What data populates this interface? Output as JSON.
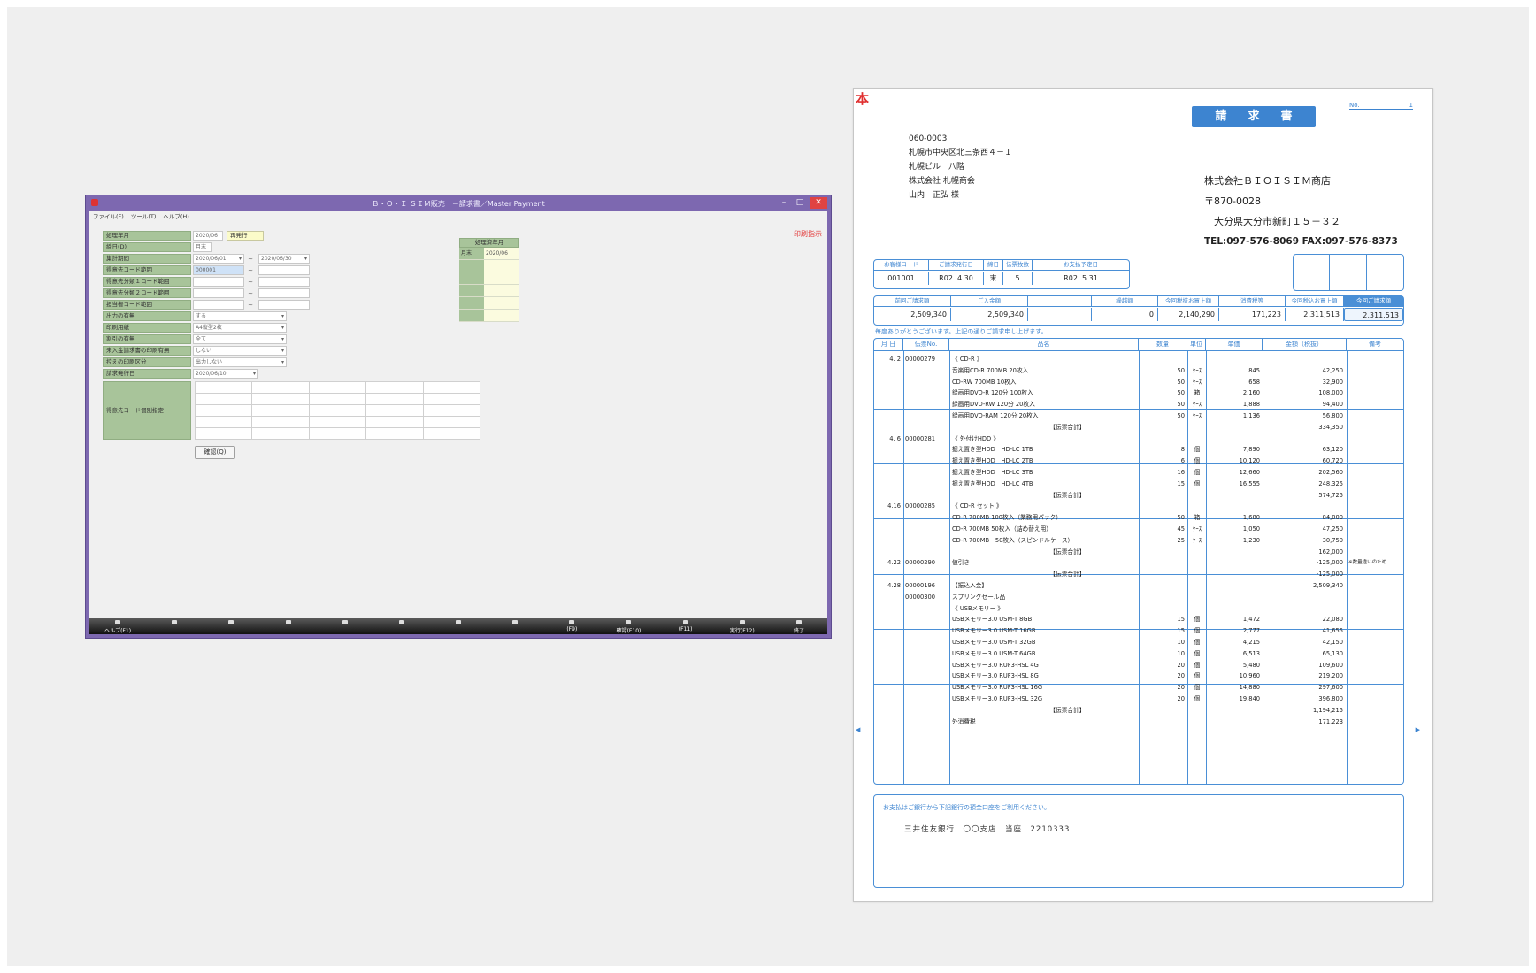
{
  "app": {
    "title": "Ｂ・Ｏ・Ｉ  ＳＩＭ販売　－請求書／Master Payment",
    "menu": [
      "ファイル(F)",
      "ツール(T)",
      "ヘルプ(H)"
    ],
    "status_red": "印刷指示",
    "fields": [
      {
        "label": "処理年月",
        "value": "2020/06",
        "extra": "再発行"
      },
      {
        "label": "締日(D)",
        "value": "月末"
      },
      {
        "label": "集計期間",
        "from": "2020/06/01",
        "to": "2020/06/30"
      },
      {
        "label": "得意先コード範囲",
        "from": "000001",
        "to": ""
      },
      {
        "label": "得意先分類１コード範囲",
        "from": "",
        "to": ""
      },
      {
        "label": "得意先分類２コード範囲",
        "from": "",
        "to": ""
      },
      {
        "label": "担当者コード範囲",
        "from": "",
        "to": ""
      },
      {
        "label": "出力の有無",
        "value": "する"
      },
      {
        "label": "印刷用紙",
        "value": "A4縦型2枚"
      },
      {
        "label": "割引の有無",
        "value": "全て"
      },
      {
        "label": "未入金請求書の印刷有無",
        "value": "しない"
      },
      {
        "label": "控えの印刷区分",
        "value": "出力しない"
      },
      {
        "label": "請求発行日",
        "value": "2020/06/10"
      }
    ],
    "multi_label": "得意先コード個別指定",
    "confirm_label": "確認(Q)",
    "side_panel": {
      "header": "処理済年月",
      "rows": [
        {
          "k": "月末",
          "v": "2020/06"
        },
        {
          "k": "",
          "v": ""
        },
        {
          "k": "",
          "v": ""
        },
        {
          "k": "",
          "v": ""
        },
        {
          "k": "",
          "v": ""
        },
        {
          "k": "",
          "v": ""
        }
      ]
    },
    "fkeys": [
      "ヘルプ(F1)",
      "",
      "",
      "",
      "",
      "",
      "",
      "",
      "(F9)",
      "確認(F10)",
      "(F11)",
      "実行(F12)",
      "終了"
    ]
  },
  "invoice": {
    "mark": "本",
    "title": "請求書",
    "no_label": "No.",
    "no_value": "1",
    "customer": [
      "060-0003",
      "札幌市中央区北三条西４－１",
      "札幌ビル　八階",
      "株式会社 札幌商会",
      "山内　正弘 様"
    ],
    "company": [
      "株式会社ＢＩＯＩＳＩＭ商店",
      "〒870-0028",
      "　大分県大分市新町１５－３２"
    ],
    "company_tel": "TEL:097-576-8069 FAX:097-576-8373",
    "info_headers": [
      "お客様コード",
      "ご請求発行日",
      "締日",
      "伝票枚数",
      "お支払予定日"
    ],
    "info_values": [
      "001001",
      "R02. 4.30",
      "末",
      "5",
      "R02. 5.31"
    ],
    "summary_headers": [
      "前回ご請求額",
      "ご入金額",
      "",
      "繰越額",
      "今回税抜お買上額",
      "消費税等",
      "今回税込お買上額",
      "今回ご請求額"
    ],
    "summary_values": [
      "2,509,340",
      "2,509,340",
      "",
      "0",
      "2,140,290",
      "171,223",
      "2,311,513",
      "2,311,513"
    ],
    "thanks": "毎度ありがとうございます。上記の通りご請求申し上げます。",
    "detail_headers": [
      "月 日",
      "伝票No.",
      "品名",
      "数量",
      "単位",
      "単価",
      "金額（税抜）",
      "備考"
    ],
    "rows": [
      {
        "date": "4. 2",
        "slip": "00000279",
        "name": "《 CD-R 》",
        "qty": "",
        "unit": "",
        "price": "",
        "amt": "",
        "note": ""
      },
      {
        "date": "",
        "slip": "",
        "name": "音楽用CD-R 700MB 20枚入",
        "qty": "50",
        "unit": "ｹｰｽ",
        "price": "845",
        "amt": "42,250",
        "note": ""
      },
      {
        "date": "",
        "slip": "",
        "name": "CD-RW 700MB 10枚入",
        "qty": "50",
        "unit": "ｹｰｽ",
        "price": "658",
        "amt": "32,900",
        "note": ""
      },
      {
        "date": "",
        "slip": "",
        "name": "録画用DVD-R 120分 100枚入",
        "qty": "50",
        "unit": "箱",
        "price": "2,160",
        "amt": "108,000",
        "note": ""
      },
      {
        "date": "",
        "slip": "",
        "name": "録画用DVD-RW 120分 20枚入",
        "qty": "50",
        "unit": "ｹｰｽ",
        "price": "1,888",
        "amt": "94,400",
        "note": ""
      },
      {
        "date": "",
        "slip": "",
        "name": "録画用DVD-RAM 120分 20枚入",
        "qty": "50",
        "unit": "ｹｰｽ",
        "price": "1,136",
        "amt": "56,800",
        "note": ""
      },
      {
        "date": "",
        "slip": "",
        "name": "　　　　　　　　　　　　　　　　　【伝票合計】",
        "qty": "",
        "unit": "",
        "price": "",
        "amt": "334,350",
        "note": ""
      },
      {
        "date": "4. 6",
        "slip": "00000281",
        "name": "《 外付けHDD 》",
        "qty": "",
        "unit": "",
        "price": "",
        "amt": "",
        "note": ""
      },
      {
        "date": "",
        "slip": "",
        "name": "据え置き型HDD　HD-LC 1TB",
        "qty": "8",
        "unit": "個",
        "price": "7,890",
        "amt": "63,120",
        "note": ""
      },
      {
        "date": "",
        "slip": "",
        "name": "据え置き型HDD　HD-LC 2TB",
        "qty": "6",
        "unit": "個",
        "price": "10,120",
        "amt": "60,720",
        "note": ""
      },
      {
        "date": "",
        "slip": "",
        "name": "据え置き型HDD　HD-LC 3TB",
        "qty": "16",
        "unit": "個",
        "price": "12,660",
        "amt": "202,560",
        "note": ""
      },
      {
        "date": "",
        "slip": "",
        "name": "据え置き型HDD　HD-LC 4TB",
        "qty": "15",
        "unit": "個",
        "price": "16,555",
        "amt": "248,325",
        "note": ""
      },
      {
        "date": "",
        "slip": "",
        "name": "　　　　　　　　　　　　　　　　　【伝票合計】",
        "qty": "",
        "unit": "",
        "price": "",
        "amt": "574,725",
        "note": ""
      },
      {
        "date": "4.16",
        "slip": "00000285",
        "name": "《 CD-R セット 》",
        "qty": "",
        "unit": "",
        "price": "",
        "amt": "",
        "note": ""
      },
      {
        "date": "",
        "slip": "",
        "name": "CD-R 700MB 100枚入（業務用パック）",
        "qty": "50",
        "unit": "箱",
        "price": "1,680",
        "amt": "84,000",
        "note": ""
      },
      {
        "date": "",
        "slip": "",
        "name": "CD-R 700MB 50枚入（詰め替え用）",
        "qty": "45",
        "unit": "ｹｰｽ",
        "price": "1,050",
        "amt": "47,250",
        "note": ""
      },
      {
        "date": "",
        "slip": "",
        "name": "CD-R 700MB　50枚入（スピンドルケース）",
        "qty": "25",
        "unit": "ｹｰｽ",
        "price": "1,230",
        "amt": "30,750",
        "note": ""
      },
      {
        "date": "",
        "slip": "",
        "name": "　　　　　　　　　　　　　　　　　【伝票合計】",
        "qty": "",
        "unit": "",
        "price": "",
        "amt": "162,000",
        "note": ""
      },
      {
        "date": "4.22",
        "slip": "00000290",
        "name": "値引き",
        "qty": "",
        "unit": "",
        "price": "",
        "amt": "-125,000",
        "note": "※数量違いのため"
      },
      {
        "date": "",
        "slip": "",
        "name": "　　　　　　　　　　　　　　　　　【伝票合計】",
        "qty": "",
        "unit": "",
        "price": "",
        "amt": "-125,000",
        "note": ""
      },
      {
        "date": "4.28",
        "slip": "00000196",
        "name": "【振込入金】",
        "qty": "",
        "unit": "",
        "price": "",
        "amt": "2,509,340",
        "note": ""
      },
      {
        "date": "",
        "slip": "00000300",
        "name": "スプリングセール品",
        "qty": "",
        "unit": "",
        "price": "",
        "amt": "",
        "note": ""
      },
      {
        "date": "",
        "slip": "",
        "name": "《 USBメモリー 》",
        "qty": "",
        "unit": "",
        "price": "",
        "amt": "",
        "note": ""
      },
      {
        "date": "",
        "slip": "",
        "name": "USBメモリー3.0 USM-T 8GB",
        "qty": "15",
        "unit": "個",
        "price": "1,472",
        "amt": "22,080",
        "note": ""
      },
      {
        "date": "",
        "slip": "",
        "name": "USBメモリー3.0 USM-T 16GB",
        "qty": "15",
        "unit": "個",
        "price": "2,777",
        "amt": "41,655",
        "note": ""
      },
      {
        "date": "",
        "slip": "",
        "name": "USBメモリー3.0 USM-T 32GB",
        "qty": "10",
        "unit": "個",
        "price": "4,215",
        "amt": "42,150",
        "note": ""
      },
      {
        "date": "",
        "slip": "",
        "name": "USBメモリー3.0 USM-T 64GB",
        "qty": "10",
        "unit": "個",
        "price": "6,513",
        "amt": "65,130",
        "note": ""
      },
      {
        "date": "",
        "slip": "",
        "name": "USBメモリー3.0 RUF3-HSL 4G",
        "qty": "20",
        "unit": "個",
        "price": "5,480",
        "amt": "109,600",
        "note": ""
      },
      {
        "date": "",
        "slip": "",
        "name": "USBメモリー3.0 RUF3-HSL 8G",
        "qty": "20",
        "unit": "個",
        "price": "10,960",
        "amt": "219,200",
        "note": ""
      },
      {
        "date": "",
        "slip": "",
        "name": "USBメモリー3.0 RUF3-HSL 16G",
        "qty": "20",
        "unit": "個",
        "price": "14,880",
        "amt": "297,600",
        "note": ""
      },
      {
        "date": "",
        "slip": "",
        "name": "USBメモリー3.0 RUF3-HSL 32G",
        "qty": "20",
        "unit": "個",
        "price": "19,840",
        "amt": "396,800",
        "note": ""
      },
      {
        "date": "",
        "slip": "",
        "name": "　　　　　　　　　　　　　　　　　【伝票合計】",
        "qty": "",
        "unit": "",
        "price": "",
        "amt": "1,194,215",
        "note": ""
      },
      {
        "date": "",
        "slip": "",
        "name": "外消費税",
        "qty": "",
        "unit": "",
        "price": "",
        "amt": "171,223",
        "note": ""
      }
    ],
    "bank_note": "お支払はご銀行から下記銀行の預金口座をご利用ください。",
    "bank_account": "三井住友銀行　〇〇支店　当座　2210333",
    "accent": "#3d84d0"
  }
}
